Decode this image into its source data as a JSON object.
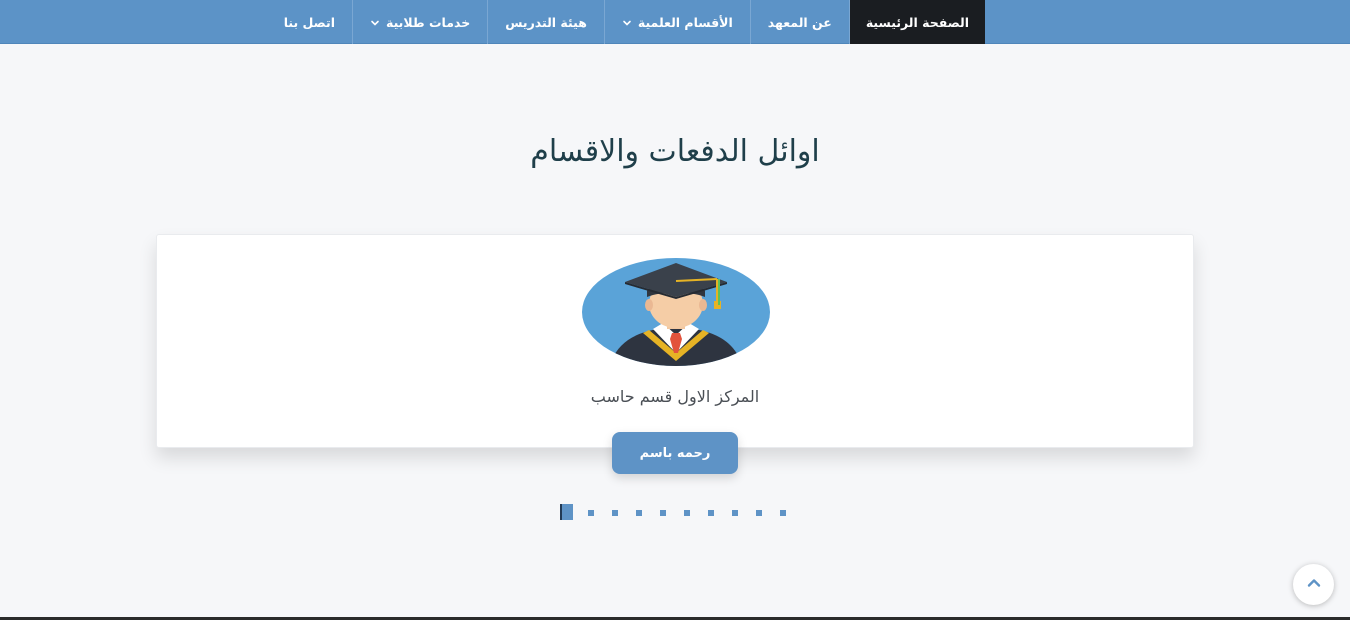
{
  "nav": {
    "items": [
      {
        "label": "الصفحة الرئيسية",
        "active": true,
        "dropdown": false
      },
      {
        "label": "عن المعهد",
        "active": false,
        "dropdown": false
      },
      {
        "label": "الأقسام العلمية",
        "active": false,
        "dropdown": true
      },
      {
        "label": "هيئة التدريس",
        "active": false,
        "dropdown": false
      },
      {
        "label": "خدمات طلابية",
        "active": false,
        "dropdown": true
      },
      {
        "label": "اتصل بنا",
        "active": false,
        "dropdown": false
      }
    ]
  },
  "section": {
    "title": "اوائل الدفعات والاقسام"
  },
  "card": {
    "avatar_icon": "graduate-avatar-icon",
    "caption": "المركز الاول قسم حاسب",
    "name_button": "رحمه باسم"
  },
  "carousel": {
    "total_slides": 10,
    "active_index": 0
  },
  "scroll_top": {
    "icon": "chevron-up-icon"
  },
  "colors": {
    "nav_bg": "#5c93c7",
    "nav_active": "#1a1d21",
    "accent": "#5e93c6",
    "title": "#1f3f4a"
  }
}
